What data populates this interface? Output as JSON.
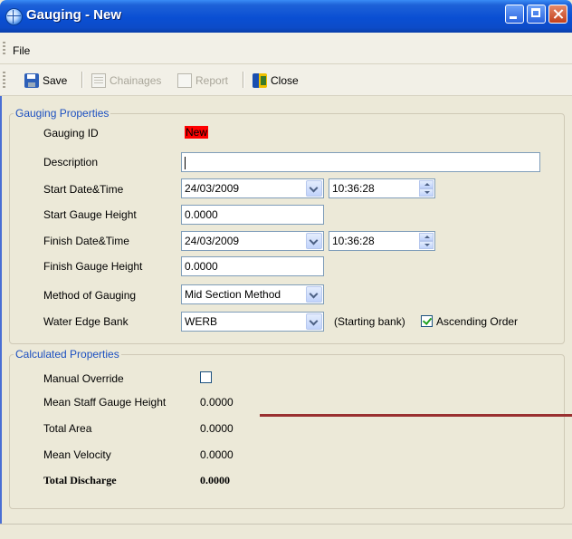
{
  "window": {
    "title": "Gauging - New"
  },
  "menu": {
    "file": "File"
  },
  "toolbar": {
    "save": "Save",
    "chainages": "Chainages",
    "report": "Report",
    "close": "Close"
  },
  "gauging_properties": {
    "legend": "Gauging Properties",
    "gauging_id_label": "Gauging ID",
    "gauging_id_value": "New",
    "description_label": "Description",
    "description_value": "",
    "start_datetime_label": "Start Date&Time",
    "start_date": "24/03/2009",
    "start_time": "10:36:28",
    "start_gauge_height_label": "Start Gauge Height",
    "start_gauge_height": "0.0000",
    "finish_datetime_label": "Finish Date&Time",
    "finish_date": "24/03/2009",
    "finish_time": "10:36:28",
    "finish_gauge_height_label": "Finish Gauge Height",
    "finish_gauge_height": "0.0000",
    "method_label": "Method of Gauging",
    "method_value": "Mid Section Method",
    "water_edge_label": "Water Edge Bank",
    "water_edge_value": "WERB",
    "starting_bank_text": "(Starting bank)",
    "ascending_order_label": "Ascending Order",
    "ascending_order_checked": true
  },
  "calculated_properties": {
    "legend": "Calculated Properties",
    "manual_override_label": "Manual Override",
    "manual_override_checked": false,
    "mean_staff_gauge_height_label": "Mean Staff Gauge Height",
    "mean_staff_gauge_height": "0.0000",
    "total_area_label": "Total Area",
    "total_area": "0.0000",
    "mean_velocity_label": "Mean Velocity",
    "mean_velocity": "0.0000",
    "total_discharge_label": "Total Discharge",
    "total_discharge": "0.0000"
  },
  "colors": {
    "title_bar": "#0a4fd3",
    "legend_text": "#1b4fc0",
    "new_badge": "#ff0000",
    "annotation_line": "#9a3030"
  }
}
